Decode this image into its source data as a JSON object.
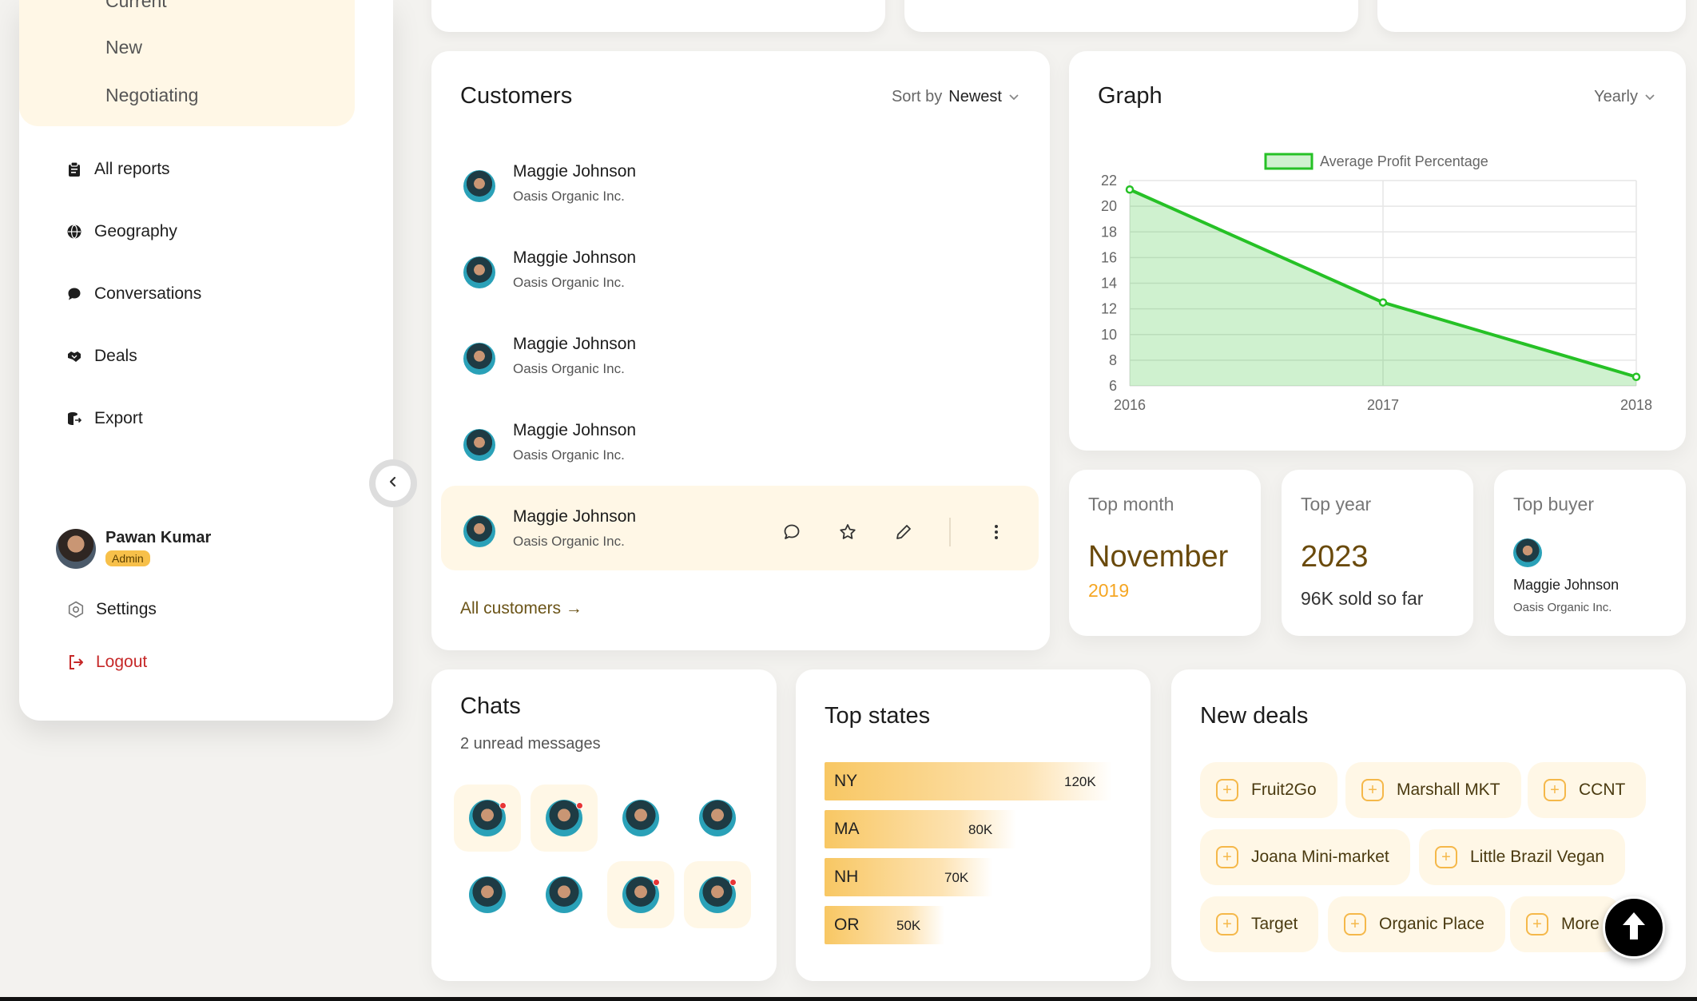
{
  "sidebar": {
    "sub_items": [
      "Current",
      "New",
      "Negotiating"
    ],
    "nav": [
      {
        "label": "All reports",
        "icon": "clipboard-icon"
      },
      {
        "label": "Geography",
        "icon": "globe-icon"
      },
      {
        "label": "Conversations",
        "icon": "chat-bubble-icon"
      },
      {
        "label": "Deals",
        "icon": "handshake-icon"
      },
      {
        "label": "Export",
        "icon": "export-icon"
      }
    ],
    "user": {
      "name": "Pawan Kumar",
      "role": "Admin"
    },
    "settings_label": "Settings",
    "logout_label": "Logout"
  },
  "customers": {
    "title": "Customers",
    "sort_prefix": "Sort by",
    "sort_value": "Newest",
    "rows": [
      {
        "name": "Maggie Johnson",
        "company": "Oasis Organic Inc."
      },
      {
        "name": "Maggie Johnson",
        "company": "Oasis Organic Inc."
      },
      {
        "name": "Maggie Johnson",
        "company": "Oasis Organic Inc."
      },
      {
        "name": "Maggie Johnson",
        "company": "Oasis Organic Inc."
      },
      {
        "name": "Maggie Johnson",
        "company": "Oasis Organic Inc."
      }
    ],
    "all_link": "All customers"
  },
  "graph": {
    "title": "Graph",
    "period": "Yearly"
  },
  "chart_data": {
    "type": "area",
    "x": [
      "2016",
      "2017",
      "2018"
    ],
    "series": [
      {
        "name": "Average Profit Percentage",
        "values": [
          21.3,
          12.5,
          6.7
        ],
        "color": "#26c126"
      }
    ],
    "ylim": [
      6,
      22
    ],
    "yticks": [
      6,
      8,
      10,
      12,
      14,
      16,
      18,
      20,
      22
    ],
    "grid": true,
    "legend": "top"
  },
  "stats": {
    "top_month": {
      "label": "Top month",
      "value": "November",
      "sub": "2019"
    },
    "top_year": {
      "label": "Top year",
      "value": "2023",
      "sub": "96K sold so far"
    },
    "top_buyer": {
      "label": "Top buyer",
      "name": "Maggie Johnson",
      "company": "Oasis Organic Inc."
    }
  },
  "chats": {
    "title": "Chats",
    "subtitle": "2 unread messages",
    "unread_flags": [
      true,
      true,
      false,
      false,
      false,
      false,
      true,
      true
    ]
  },
  "states": {
    "title": "Top states",
    "items": [
      {
        "code": "NY",
        "value": "120K",
        "amount": 120
      },
      {
        "code": "MA",
        "value": "80K",
        "amount": 80
      },
      {
        "code": "NH",
        "value": "70K",
        "amount": 70
      },
      {
        "code": "OR",
        "value": "50K",
        "amount": 50
      }
    ]
  },
  "deals": {
    "title": "New deals",
    "items": [
      "Fruit2Go",
      "Marshall MKT",
      "CCNT",
      "Joana Mini-market",
      "Little Brazil Vegan",
      "Target",
      "Organic Place",
      "More"
    ]
  },
  "colors": {
    "accent": "#f5b84a",
    "cream": "#fff7e6",
    "brown": "#6a4a0c",
    "logout": "#c62828"
  }
}
